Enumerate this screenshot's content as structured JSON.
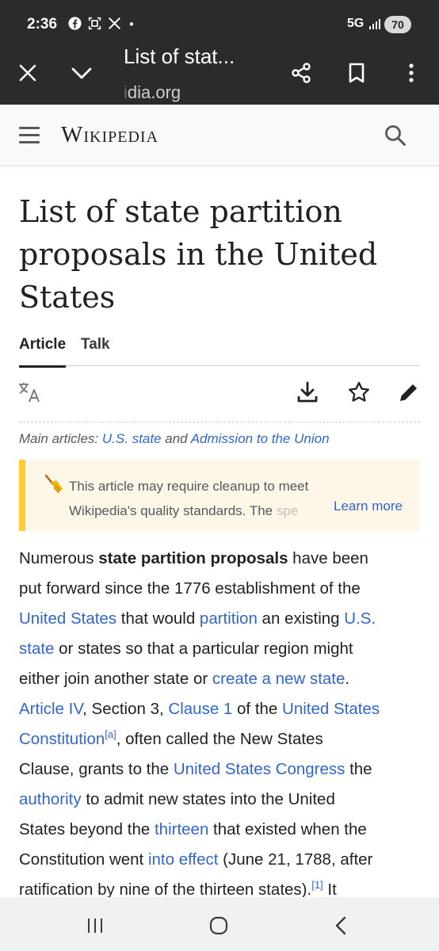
{
  "status_bar": {
    "time": "2:36",
    "icons": [
      "facebook-icon",
      "screenshot-icon",
      "x-icon",
      "dot"
    ],
    "network": "5G",
    "battery": "70"
  },
  "toolbar": {
    "title": "List of stat...",
    "url_faded": "i",
    "url": "dia.org"
  },
  "wiki": {
    "logo": "Wikipedia"
  },
  "page": {
    "title": "List of state partition proposals in the United States",
    "tabs": [
      {
        "label": "Article"
      },
      {
        "label": "Talk"
      }
    ]
  },
  "hatnote": {
    "prefix": "Main articles: ",
    "link1": "U.S. state",
    "and": " and ",
    "link2": "Admission to the Union"
  },
  "cleanup": {
    "line1": "This article may require cleanup to meet",
    "line2": "Wikipedia's quality standards. The ",
    "line2_cut": "spe",
    "learn_more": "Learn more"
  },
  "body": {
    "l1_a": "Numerous ",
    "l1_b": "state partition proposals",
    "l1_c": " have been",
    "l2": "put forward since the 1776 establishment of the",
    "l3_a": "United States",
    "l3_b": " that would ",
    "l3_c": "partition",
    "l3_d": " an existing ",
    "l3_e": "U.S.",
    "l4_a": "state",
    "l4_b": " or states so that a particular region might",
    "l5_a": "either join another state or ",
    "l5_b": "create a new state",
    "l5_c": ".",
    "l6_a": "Article IV",
    "l6_b": ", Section 3, ",
    "l6_c": "Clause 1",
    "l6_d": " of the ",
    "l6_e": "United States",
    "l7_a": "Constitution",
    "l7_sup": "[a]",
    "l7_b": ", often called the New States",
    "l8_a": "Clause, grants to the ",
    "l8_b": "United States Congress",
    "l8_c": " the",
    "l9_a": "authority",
    "l9_b": " to admit new states into the United",
    "l10_a": "States beyond the ",
    "l10_b": "thirteen",
    "l10_c": " that existed when the",
    "l11_a": "Constitution went ",
    "l11_b": "into effect",
    "l11_c": " (June 21, 1788, after",
    "l12_a": "ratification by nine of the thirteen states).",
    "l12_sup": "[1]",
    "l12_b": " It"
  }
}
